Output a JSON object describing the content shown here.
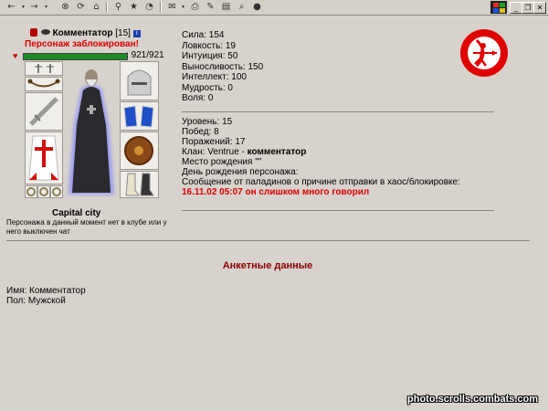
{
  "toolbar": {
    "icons": [
      "back-icon",
      "forward-icon",
      "stop-icon",
      "refresh-icon",
      "home-icon",
      "search-icon",
      "favorites-icon",
      "history-icon",
      "mail-icon",
      "print-icon",
      "edit-icon",
      "discuss-icon",
      "research-icon",
      "messenger-icon"
    ]
  },
  "window": {
    "minimize": "_",
    "restore": "❐",
    "close": "✕"
  },
  "character": {
    "name": "Комментатор",
    "level": "[15]",
    "info_badge": "i",
    "blocked": "Персонаж заблокирован!",
    "hp": "921/921",
    "hp_fraction": 1.0,
    "hp_color": "#1e8a28",
    "city": "Capital city",
    "chat_note": "Персонажа в данный момент нет в клубе или у него выключен чат"
  },
  "stats": {
    "lines": [
      "Сила: 154",
      "Ловкость: 19",
      "Интуиция: 50",
      "Выносливость: 150",
      "Интеллект: 100",
      "Мудрость: 0",
      "Воля: 0"
    ],
    "level": "Уровень: 15",
    "wins": "Побед: 8",
    "losses": "Поражений: 17",
    "clan_prefix": "Клан: Ventrue - ",
    "clan_role": "комментатор",
    "birthplace": "Место рождения \"\"",
    "birthday": "День рождения персонажа:",
    "paladin_message": "Сообщение от паладинов о причине отправки в хаос/блокировке:",
    "reason": "16.11.02 05:07 он слишком много говорил"
  },
  "section_title": "Анкетные данные",
  "profile": {
    "name": "Имя: Комментатор",
    "gender": "Пол: Мужской"
  },
  "watermark": "photo.scrolls.combats.com",
  "colors": {
    "accent_red": "#e00000",
    "title": "#8b0000",
    "emblem": "#e00000"
  }
}
